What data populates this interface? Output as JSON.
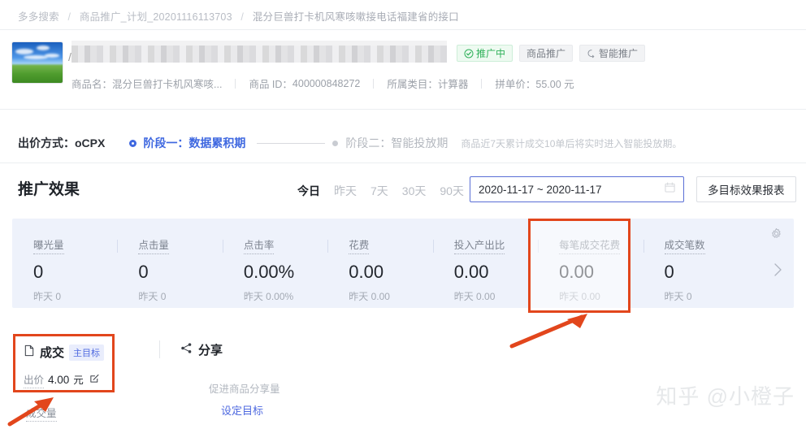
{
  "breadcrumb": {
    "items": [
      "多多搜索",
      "商品推广_计划_20201116113703",
      "混分巨兽打卡机风寒咳嗽接电话福建省的接口"
    ],
    "separator": "/"
  },
  "product": {
    "title_masked": "",
    "badges": [
      {
        "label": "推广中",
        "icon": "check-circle-icon",
        "color": "#2fb159"
      },
      {
        "label": "商品推广",
        "icon": "",
        "color": "#7a7f87"
      },
      {
        "label": "智能推广",
        "icon": "sparkle-icon",
        "color": "#7a7f87"
      }
    ],
    "meta": [
      {
        "label": "商品名：",
        "value": "混分巨兽打卡机风寒咳..."
      },
      {
        "label": "商品 ID：",
        "value": "400000848272"
      },
      {
        "label": "所属类目：",
        "value": "计算器"
      },
      {
        "label": "拼单价：",
        "value": "55.00 元"
      }
    ]
  },
  "bid": {
    "label": "出价方式：oCPX",
    "stage1": "阶段一：数据累积期",
    "stage2": "阶段二：智能投放期",
    "note": "商品近7天累计成交10单后将实时进入智能投放期。"
  },
  "effect": {
    "title": "推广效果",
    "ranges": [
      {
        "label": "今日",
        "active": true
      },
      {
        "label": "昨天",
        "active": false
      },
      {
        "label": "7天",
        "active": false
      },
      {
        "label": "30天",
        "active": false
      },
      {
        "label": "90天",
        "active": false
      }
    ],
    "date_value": "2020-11-17 ~ 2020-11-17",
    "report_button": "多目标效果报表"
  },
  "metrics": [
    {
      "label": "曝光量",
      "value": "0",
      "sub": "昨天 0",
      "highlight": false
    },
    {
      "label": "点击量",
      "value": "0",
      "sub": "昨天 0",
      "highlight": false
    },
    {
      "label": "点击率",
      "value": "0.00%",
      "sub": "昨天 0.00%",
      "highlight": false
    },
    {
      "label": "花费",
      "value": "0.00",
      "sub": "昨天 0.00",
      "highlight": false
    },
    {
      "label": "投入产出比",
      "value": "0.00",
      "sub": "昨天 0.00",
      "highlight": false
    },
    {
      "label": "每笔成交花费",
      "value": "0.00",
      "sub": "昨天 0.00",
      "highlight": true
    },
    {
      "label": "成交笔数",
      "value": "0",
      "sub": "昨天 0",
      "highlight": false
    }
  ],
  "goals": {
    "deal": {
      "name": "成交",
      "tag": "主目标",
      "bid_label": "出价",
      "bid_amount": "4.00",
      "bid_unit": "元",
      "icon": "document-icon",
      "edit_icon": "edit-icon"
    },
    "share": {
      "name": "分享",
      "icon": "share-icon",
      "desc": "促进商品分享量",
      "link": "设定目标"
    },
    "bottom_label": "成交量"
  },
  "watermark": "知乎 @小橙子",
  "colors": {
    "accent_blue": "#3f68e0",
    "highlight_red": "#e2461c",
    "panel_bg": "#eef2fb",
    "success_green": "#2fb159"
  }
}
